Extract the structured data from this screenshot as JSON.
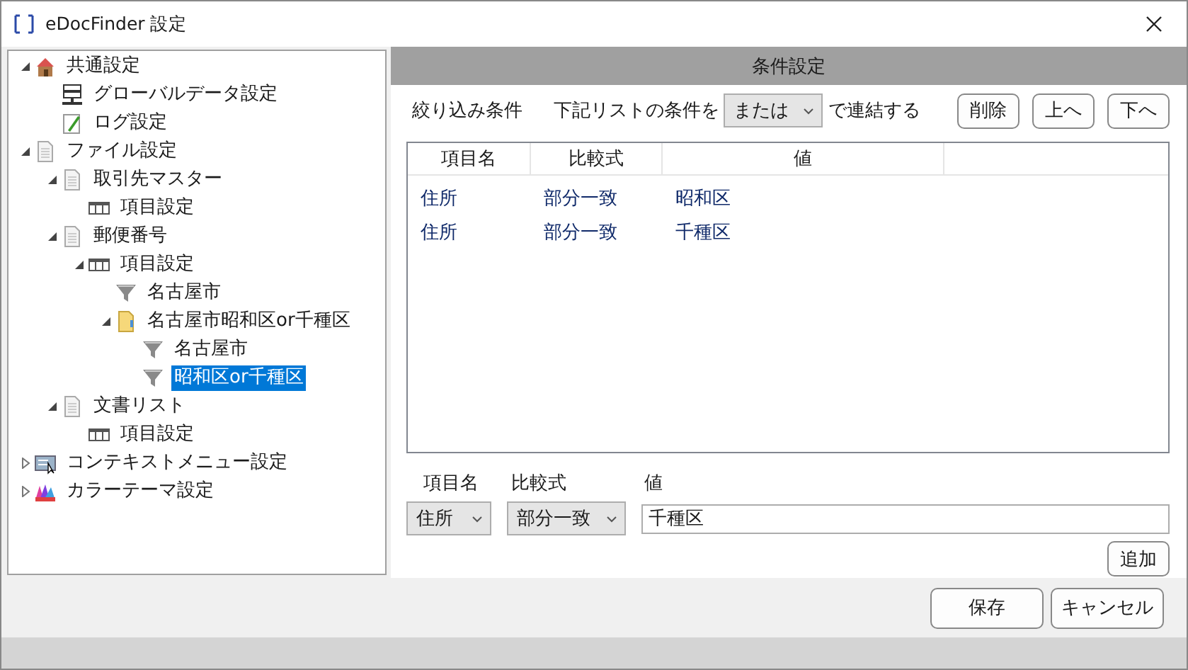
{
  "window": {
    "title": "eDocFinder 設定"
  },
  "tree": [
    {
      "label": "共通設定",
      "kind": "house",
      "expanded": true,
      "selected": false,
      "children": [
        {
          "label": "グローバルデータ設定",
          "kind": "server",
          "selected": false
        },
        {
          "label": "ログ設定",
          "kind": "pencil",
          "selected": false
        }
      ]
    },
    {
      "label": "ファイル設定",
      "kind": "document",
      "expanded": true,
      "selected": false,
      "children": [
        {
          "label": "取引先マスター",
          "kind": "document",
          "expanded": true,
          "selected": false,
          "children": [
            {
              "label": "項目設定",
              "kind": "table",
              "selected": false
            }
          ]
        },
        {
          "label": "郵便番号",
          "kind": "document",
          "expanded": true,
          "selected": false,
          "children": [
            {
              "label": "項目設定",
              "kind": "table",
              "expanded": true,
              "selected": false,
              "children": [
                {
                  "label": "名古屋市",
                  "kind": "filter",
                  "selected": false
                },
                {
                  "label": "名古屋市昭和区or千種区",
                  "kind": "folder",
                  "expanded": true,
                  "selected": false,
                  "children": [
                    {
                      "label": "名古屋市",
                      "kind": "filter",
                      "selected": false
                    },
                    {
                      "label": "昭和区or千種区",
                      "kind": "filter",
                      "selected": true
                    }
                  ]
                }
              ]
            }
          ]
        },
        {
          "label": "文書リスト",
          "kind": "document",
          "expanded": true,
          "selected": false,
          "children": [
            {
              "label": "項目設定",
              "kind": "table",
              "selected": false
            }
          ]
        }
      ]
    },
    {
      "label": "コンテキストメニュー設定",
      "kind": "menu",
      "expanded": false,
      "selected": false
    },
    {
      "label": "カラーテーマ設定",
      "kind": "palette",
      "expanded": false,
      "selected": false
    }
  ],
  "panel": {
    "title": "条件設定",
    "filter_label": "絞り込み条件",
    "join_prefix": "下記リストの条件を",
    "join_select": {
      "value": "または"
    },
    "join_suffix": "で連結する",
    "buttons": [
      "削除",
      "上へ",
      "下へ"
    ],
    "list": {
      "columns": [
        "項目名",
        "比較式",
        "値"
      ],
      "rows": [
        [
          "住所",
          "部分一致",
          "昭和区"
        ],
        [
          "住所",
          "部分一致",
          "千種区"
        ]
      ]
    },
    "editor": {
      "labels": [
        "項目名",
        "比較式",
        "値"
      ],
      "field_select": {
        "value": "住所"
      },
      "operator_select": {
        "value": "部分一致"
      },
      "value_input": {
        "value": "千種区"
      },
      "add_button": "追加"
    }
  },
  "footer": {
    "buttons": [
      "保存",
      "キャンセル"
    ]
  }
}
